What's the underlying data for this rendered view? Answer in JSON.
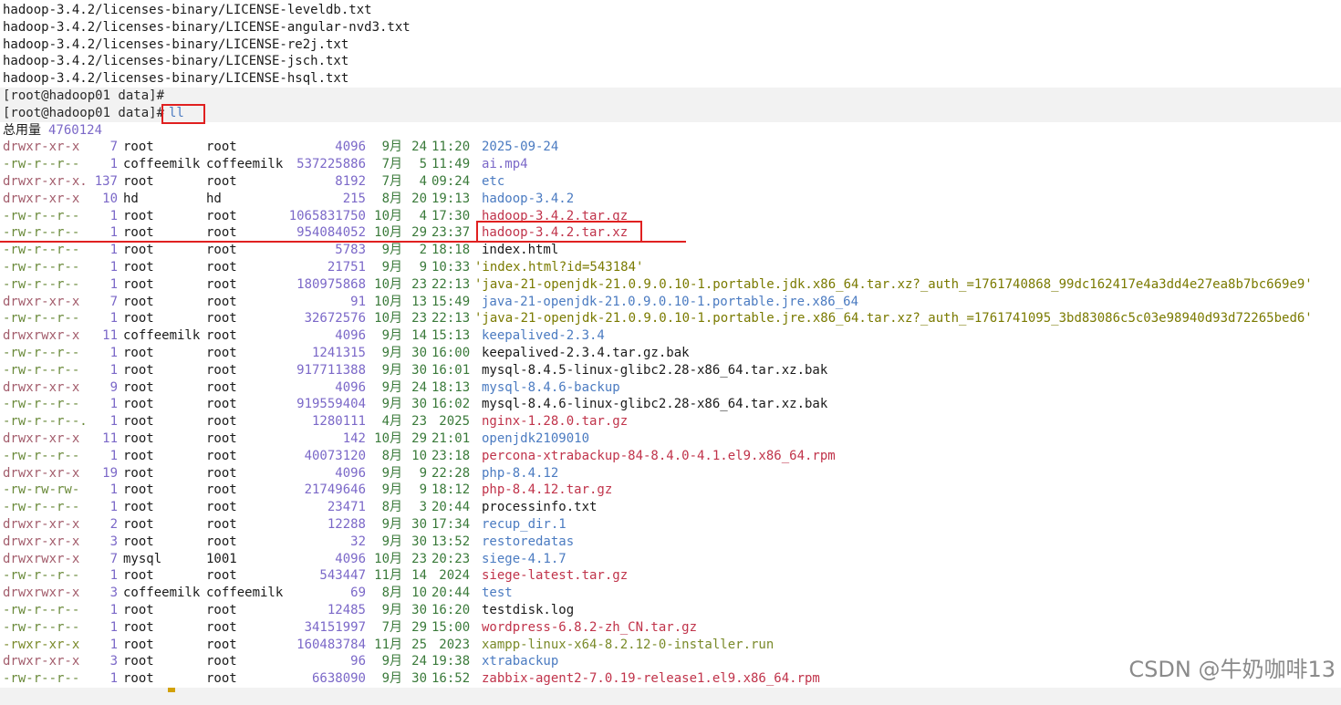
{
  "preamble": [
    "hadoop-3.4.2/licenses-binary/LICENSE-leveldb.txt",
    "hadoop-3.4.2/licenses-binary/LICENSE-angular-nvd3.txt",
    "hadoop-3.4.2/licenses-binary/LICENSE-re2j.txt",
    "hadoop-3.4.2/licenses-binary/LICENSE-jsch.txt",
    "hadoop-3.4.2/licenses-binary/LICENSE-hsql.txt"
  ],
  "prompt": "[root@hadoop01 data]#",
  "command": "ll",
  "total_label": "总用量",
  "total_value": "4760124",
  "entries": [
    {
      "perm": "drwxr-xr-x",
      "links": "7",
      "owner": "root",
      "group": "root",
      "size": "4096",
      "month": "9月",
      "day": "24",
      "time": "11:20",
      "name": "2025-09-24",
      "kind": "dir"
    },
    {
      "perm": "-rw-r--r--",
      "links": "1",
      "owner": "coffeemilk",
      "group": "coffeemilk",
      "size": "537225886",
      "month": "7月",
      "day": "5",
      "time": "11:49",
      "name": "ai.mp4",
      "kind": "media"
    },
    {
      "perm": "drwxr-xr-x.",
      "links": "137",
      "owner": "root",
      "group": "root",
      "size": "8192",
      "month": "7月",
      "day": "4",
      "time": "09:24",
      "name": "etc",
      "kind": "dir"
    },
    {
      "perm": "drwxr-xr-x",
      "links": "10",
      "owner": "hd",
      "group": "hd",
      "size": "215",
      "month": "8月",
      "day": "20",
      "time": "19:13",
      "name": "hadoop-3.4.2",
      "kind": "dir"
    },
    {
      "perm": "-rw-r--r--",
      "links": "1",
      "owner": "root",
      "group": "root",
      "size": "1065831750",
      "month": "10月",
      "day": "4",
      "time": "17:30",
      "name": "hadoop-3.4.2.tar.gz",
      "kind": "arch"
    },
    {
      "perm": "-rw-r--r--",
      "links": "1",
      "owner": "root",
      "group": "root",
      "size": "954084052",
      "month": "10月",
      "day": "29",
      "time": "23:37",
      "name": "hadoop-3.4.2.tar.xz",
      "kind": "arch"
    },
    {
      "perm": "-rw-r--r--",
      "links": "1",
      "owner": "root",
      "group": "root",
      "size": "5783",
      "month": "9月",
      "day": "2",
      "time": "18:18",
      "name": "index.html",
      "kind": "file"
    },
    {
      "perm": "-rw-r--r--",
      "links": "1",
      "owner": "root",
      "group": "root",
      "size": "21751",
      "month": "9月",
      "day": "9",
      "time": "10:33",
      "name": "'index.html?id=543184'",
      "kind": "quote"
    },
    {
      "perm": "-rw-r--r--",
      "links": "1",
      "owner": "root",
      "group": "root",
      "size": "180975868",
      "month": "10月",
      "day": "23",
      "time": "22:13",
      "name": "'java-21-openjdk-21.0.9.0.10-1.portable.jdk.x86_64.tar.xz?_auth_=1761740868_99dc162417e4a3dd4e27ea8b7bc669e9'",
      "kind": "quote"
    },
    {
      "perm": "drwxr-xr-x",
      "links": "7",
      "owner": "root",
      "group": "root",
      "size": "91",
      "month": "10月",
      "day": "13",
      "time": "15:49",
      "name": "java-21-openjdk-21.0.9.0.10-1.portable.jre.x86_64",
      "kind": "dir"
    },
    {
      "perm": "-rw-r--r--",
      "links": "1",
      "owner": "root",
      "group": "root",
      "size": "32672576",
      "month": "10月",
      "day": "23",
      "time": "22:13",
      "name": "'java-21-openjdk-21.0.9.0.10-1.portable.jre.x86_64.tar.xz?_auth_=1761741095_3bd83086c5c03e98940d93d72265bed6'",
      "kind": "quote"
    },
    {
      "perm": "drwxrwxr-x",
      "links": "11",
      "owner": "coffeemilk",
      "group": "root",
      "size": "4096",
      "month": "9月",
      "day": "14",
      "time": "15:13",
      "name": "keepalived-2.3.4",
      "kind": "dir"
    },
    {
      "perm": "-rw-r--r--",
      "links": "1",
      "owner": "root",
      "group": "root",
      "size": "1241315",
      "month": "9月",
      "day": "30",
      "time": "16:00",
      "name": "keepalived-2.3.4.tar.gz.bak",
      "kind": "file"
    },
    {
      "perm": "-rw-r--r--",
      "links": "1",
      "owner": "root",
      "group": "root",
      "size": "917711388",
      "month": "9月",
      "day": "30",
      "time": "16:01",
      "name": "mysql-8.4.5-linux-glibc2.28-x86_64.tar.xz.bak",
      "kind": "file"
    },
    {
      "perm": "drwxr-xr-x",
      "links": "9",
      "owner": "root",
      "group": "root",
      "size": "4096",
      "month": "9月",
      "day": "24",
      "time": "18:13",
      "name": "mysql-8.4.6-backup",
      "kind": "dir"
    },
    {
      "perm": "-rw-r--r--",
      "links": "1",
      "owner": "root",
      "group": "root",
      "size": "919559404",
      "month": "9月",
      "day": "30",
      "time": "16:02",
      "name": "mysql-8.4.6-linux-glibc2.28-x86_64.tar.xz.bak",
      "kind": "file"
    },
    {
      "perm": "-rw-r--r--.",
      "links": "1",
      "owner": "root",
      "group": "root",
      "size": "1280111",
      "month": "4月",
      "day": "23",
      "time": "2025",
      "name": "nginx-1.28.0.tar.gz",
      "kind": "arch"
    },
    {
      "perm": "drwxr-xr-x",
      "links": "11",
      "owner": "root",
      "group": "root",
      "size": "142",
      "month": "10月",
      "day": "29",
      "time": "21:01",
      "name": "openjdk2109010",
      "kind": "dir"
    },
    {
      "perm": "-rw-r--r--",
      "links": "1",
      "owner": "root",
      "group": "root",
      "size": "40073120",
      "month": "8月",
      "day": "10",
      "time": "23:18",
      "name": "percona-xtrabackup-84-8.4.0-4.1.el9.x86_64.rpm",
      "kind": "arch"
    },
    {
      "perm": "drwxr-xr-x",
      "links": "19",
      "owner": "root",
      "group": "root",
      "size": "4096",
      "month": "9月",
      "day": "9",
      "time": "22:28",
      "name": "php-8.4.12",
      "kind": "dir"
    },
    {
      "perm": "-rw-rw-rw-",
      "links": "1",
      "owner": "root",
      "group": "root",
      "size": "21749646",
      "month": "9月",
      "day": "9",
      "time": "18:12",
      "name": "php-8.4.12.tar.gz",
      "kind": "arch"
    },
    {
      "perm": "-rw-r--r--",
      "links": "1",
      "owner": "root",
      "group": "root",
      "size": "23471",
      "month": "8月",
      "day": "3",
      "time": "20:44",
      "name": "processinfo.txt",
      "kind": "file"
    },
    {
      "perm": "drwxr-xr-x",
      "links": "2",
      "owner": "root",
      "group": "root",
      "size": "12288",
      "month": "9月",
      "day": "30",
      "time": "17:34",
      "name": "recup_dir.1",
      "kind": "dir"
    },
    {
      "perm": "drwxr-xr-x",
      "links": "3",
      "owner": "root",
      "group": "root",
      "size": "32",
      "month": "9月",
      "day": "30",
      "time": "13:52",
      "name": "restoredatas",
      "kind": "dir"
    },
    {
      "perm": "drwxrwxr-x",
      "links": "7",
      "owner": "mysql",
      "group": "1001",
      "size": "4096",
      "month": "10月",
      "day": "23",
      "time": "20:23",
      "name": "siege-4.1.7",
      "kind": "dir"
    },
    {
      "perm": "-rw-r--r--",
      "links": "1",
      "owner": "root",
      "group": "root",
      "size": "543447",
      "month": "11月",
      "day": "14",
      "time": "2024",
      "name": "siege-latest.tar.gz",
      "kind": "arch"
    },
    {
      "perm": "drwxrwxr-x",
      "links": "3",
      "owner": "coffeemilk",
      "group": "coffeemilk",
      "size": "69",
      "month": "8月",
      "day": "10",
      "time": "20:44",
      "name": "test",
      "kind": "dir"
    },
    {
      "perm": "-rw-r--r--",
      "links": "1",
      "owner": "root",
      "group": "root",
      "size": "12485",
      "month": "9月",
      "day": "30",
      "time": "16:20",
      "name": "testdisk.log",
      "kind": "file"
    },
    {
      "perm": "-rw-r--r--",
      "links": "1",
      "owner": "root",
      "group": "root",
      "size": "34151997",
      "month": "7月",
      "day": "29",
      "time": "15:00",
      "name": "wordpress-6.8.2-zh_CN.tar.gz",
      "kind": "arch"
    },
    {
      "perm": "-rwxr-xr-x",
      "links": "1",
      "owner": "root",
      "group": "root",
      "size": "160483784",
      "month": "11月",
      "day": "25",
      "time": "2023",
      "name": "xampp-linux-x64-8.2.12-0-installer.run",
      "kind": "exe"
    },
    {
      "perm": "drwxr-xr-x",
      "links": "3",
      "owner": "root",
      "group": "root",
      "size": "96",
      "month": "9月",
      "day": "24",
      "time": "19:38",
      "name": "xtrabackup",
      "kind": "dir"
    },
    {
      "perm": "-rw-r--r--",
      "links": "1",
      "owner": "root",
      "group": "root",
      "size": "6638090",
      "month": "9月",
      "day": "30",
      "time": "16:52",
      "name": "zabbix-agent2-7.0.19-release1.el9.x86_64.rpm",
      "kind": "arch"
    }
  ],
  "watermark": "CSDN @牛奶咖啡13",
  "colors": {
    "annotation": "#e02020",
    "dir": "#4b7bc1",
    "archive": "#c0334a"
  }
}
